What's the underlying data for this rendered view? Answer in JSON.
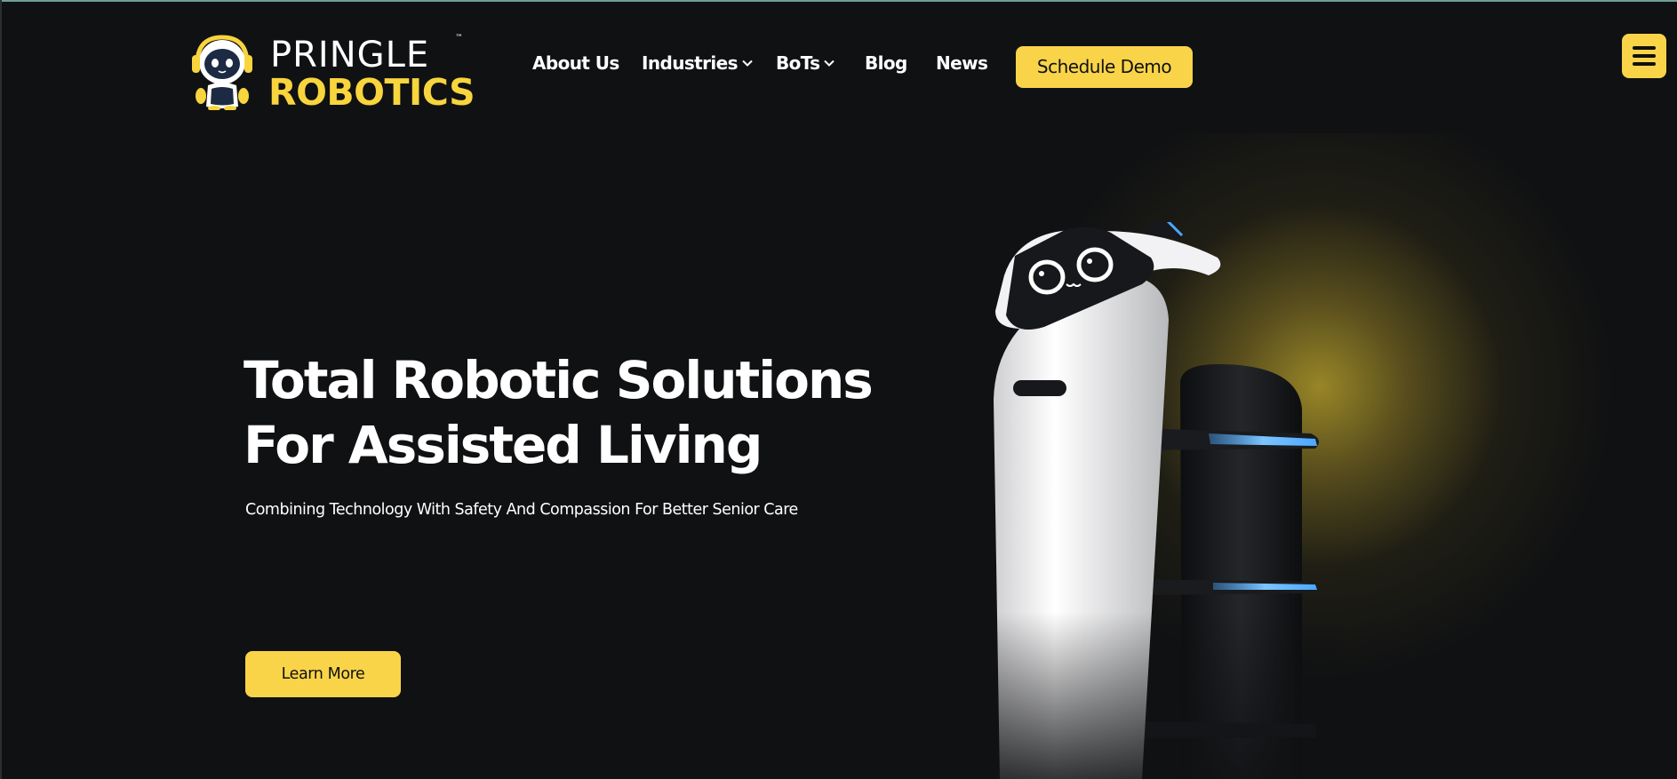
{
  "brand": {
    "line1": "PRINGLE",
    "line2": "ROBOTICS",
    "tm": "™"
  },
  "nav": {
    "items": [
      {
        "label": "About Us",
        "has_dropdown": false
      },
      {
        "label": "Industries",
        "has_dropdown": true
      },
      {
        "label": "BoTs",
        "has_dropdown": true
      },
      {
        "label": "Blog",
        "has_dropdown": false
      },
      {
        "label": "News",
        "has_dropdown": false
      }
    ],
    "cta_label": "Schedule Demo",
    "menu_icon": "hamburger-menu-icon"
  },
  "hero": {
    "title_line1": "Total Robotic Solutions",
    "title_line2": "For Assisted Living",
    "subtitle": "Combining Technology With Safety And Compassion For Better Senior Care",
    "button_label": "Learn More"
  },
  "colors": {
    "background": "#101113",
    "accent": "#f9d449",
    "text": "#ffffff",
    "glow": "#a08c28",
    "robot_led": "#4aa8ff"
  }
}
